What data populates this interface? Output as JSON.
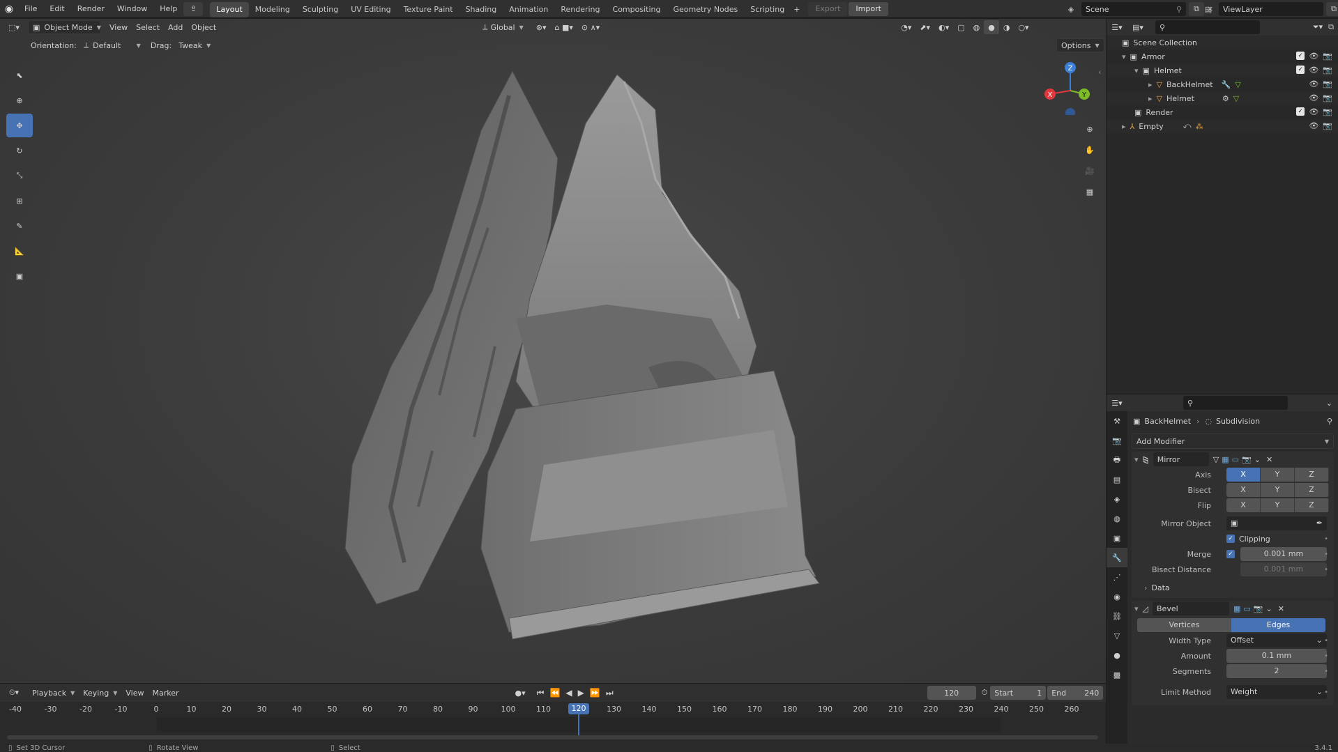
{
  "menu": [
    "File",
    "Edit",
    "Render",
    "Window",
    "Help"
  ],
  "workspaces": [
    "Layout",
    "Modeling",
    "Sculpting",
    "UV Editing",
    "Texture Paint",
    "Shading",
    "Animation",
    "Rendering",
    "Compositing",
    "Geometry Nodes",
    "Scripting"
  ],
  "active_workspace": "Layout",
  "topbar": {
    "export": "Export",
    "import": "Import",
    "scene": "Scene",
    "view_layer": "ViewLayer"
  },
  "viewport": {
    "mode": "Object Mode",
    "menus": [
      "View",
      "Select",
      "Add",
      "Object"
    ],
    "transform": "Global",
    "orientation_label": "Orientation:",
    "orientation": "Default",
    "drag_label": "Drag:",
    "drag": "Tweak",
    "options": "Options",
    "gizmo": {
      "x": "X",
      "y": "Y",
      "z": "Z"
    }
  },
  "outliner": {
    "rows": [
      {
        "label": "Scene Collection"
      },
      {
        "label": "Armor"
      },
      {
        "label": "Helmet"
      },
      {
        "label": "BackHelmet"
      },
      {
        "label": "Helmet"
      },
      {
        "label": "Render"
      },
      {
        "label": "Empty"
      }
    ]
  },
  "properties": {
    "breadcrumb_object": "BackHelmet",
    "breadcrumb_modifier": "Subdivision",
    "add_modifier": "Add Modifier",
    "mirror": {
      "name": "Mirror",
      "axis_label": "Axis",
      "bisect_label": "Bisect",
      "flip_label": "Flip",
      "xyz": [
        "X",
        "Y",
        "Z"
      ],
      "mirror_object_label": "Mirror Object",
      "clipping": "Clipping",
      "merge_label": "Merge",
      "merge_value": "0.001 mm",
      "bisect_distance_label": "Bisect Distance",
      "bisect_distance_value": "0.001 mm",
      "data": "Data"
    },
    "bevel": {
      "name": "Bevel",
      "vertices": "Vertices",
      "edges": "Edges",
      "width_type_label": "Width Type",
      "width_type": "Offset",
      "amount_label": "Amount",
      "amount": "0.1 mm",
      "segments_label": "Segments",
      "segments": "2",
      "limit_method_label": "Limit Method",
      "limit_method": "Weight"
    }
  },
  "timeline": {
    "menus": [
      "Playback",
      "Keying",
      "View",
      "Marker"
    ],
    "current_frame": "120",
    "start_label": "Start",
    "start": "1",
    "end_label": "End",
    "end": "240",
    "ticks": [
      "-40",
      "-30",
      "-20",
      "-10",
      "0",
      "10",
      "20",
      "30",
      "40",
      "50",
      "60",
      "70",
      "80",
      "90",
      "100",
      "110",
      "120",
      "130",
      "140",
      "150",
      "160",
      "170",
      "180",
      "190",
      "200",
      "210",
      "220",
      "230",
      "240",
      "250",
      "260"
    ]
  },
  "status": {
    "left": "Set 3D Cursor",
    "mid": "Rotate View",
    "right": "Select",
    "version": "3.4.1"
  },
  "colors": {
    "accent": "#4772b3",
    "x_axis": "#e0383d",
    "y_axis": "#7dbb28",
    "z_axis": "#3b7fd9",
    "frame": "#4772b3"
  }
}
